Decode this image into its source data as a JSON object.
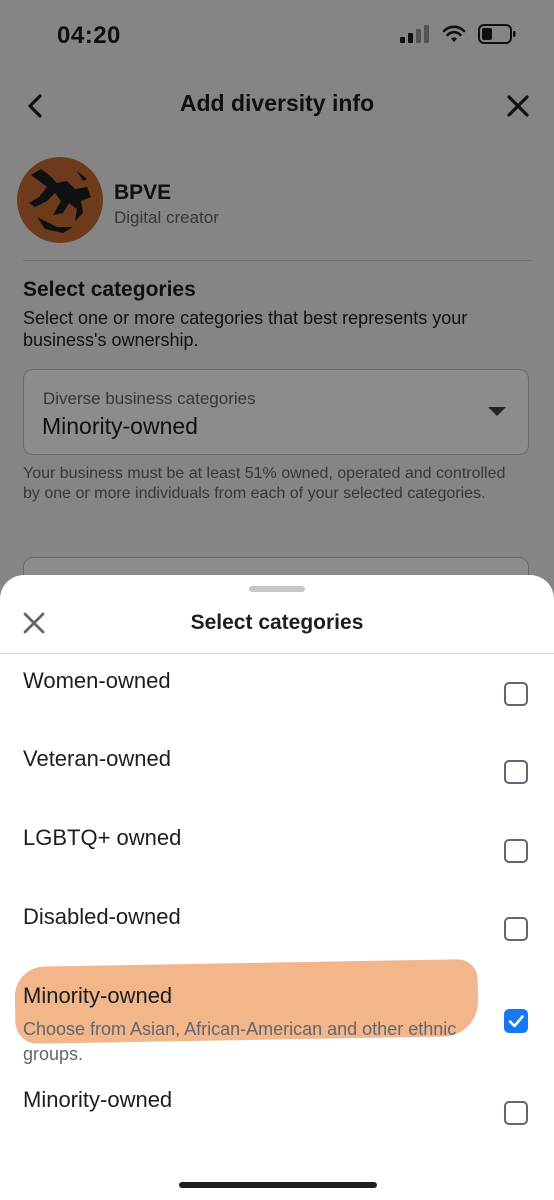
{
  "status_bar": {
    "time": "04:20"
  },
  "header": {
    "title": "Add diversity info"
  },
  "profile": {
    "name": "BPVE",
    "role": "Digital creator"
  },
  "section": {
    "title": "Select categories",
    "description": "Select one or more categories that best represents your business's ownership."
  },
  "dropdown": {
    "label": "Diverse business categories",
    "value": "Minority-owned"
  },
  "help_text": "Your business must be at least 51% owned, operated and controlled by one or more individuals from each of your selected categories.",
  "sheet": {
    "title": "Select categories",
    "options": [
      {
        "label": "Women-owned",
        "checked": false
      },
      {
        "label": "Veteran-owned",
        "checked": false
      },
      {
        "label": "LGBTQ+ owned",
        "checked": false
      },
      {
        "label": "Disabled-owned",
        "checked": false
      },
      {
        "label": "Minority-owned",
        "sublabel": "Choose from Asian, African-American and other ethnic groups.",
        "checked": true
      },
      {
        "label": "Minority-owned",
        "checked": false
      }
    ]
  },
  "colors": {
    "accent": "#1877f2",
    "avatar_bg": "#c66a32",
    "highlight": "#ec8742"
  },
  "icons": [
    "back-arrow-icon",
    "close-icon",
    "signal-icon",
    "wifi-icon",
    "battery-icon",
    "checkmark-icon",
    "dropdown-caret-icon"
  ]
}
